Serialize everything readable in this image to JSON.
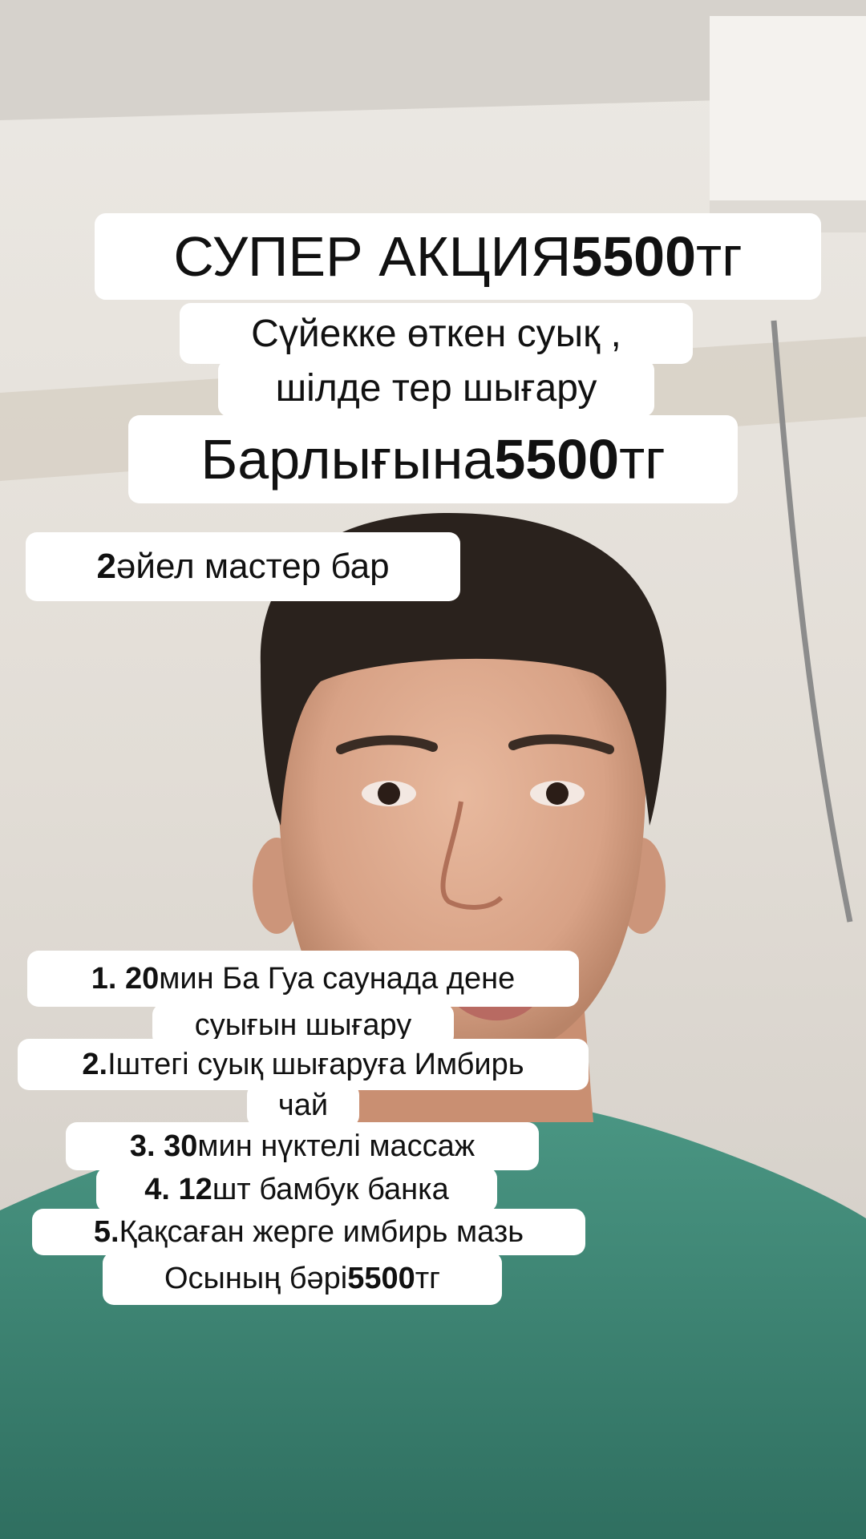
{
  "captions": {
    "headline": "СУПЕР АКЦИЯ 5500 тг",
    "headline_parts": {
      "text": "СУПЕР АКЦИЯ ",
      "number": "5500",
      "unit": " тг"
    },
    "sub1": "Сүйекке өткен суық ,",
    "sub2": "шілде тер шығару",
    "price_line": {
      "text": "Барлығына ",
      "number": "5500",
      "unit": " тг"
    },
    "masters": {
      "number": "2",
      "text": " әйел мастер бар"
    },
    "list": [
      {
        "num": "1. 20",
        "text": " мин  Ба Гуа саунада дене"
      },
      {
        "num": "",
        "text": "суығын шығару"
      },
      {
        "num": "2.",
        "text": " Іштегі суық шығаруға Имбирь"
      },
      {
        "num": "",
        "text": "чай"
      },
      {
        "num": "3. 30",
        "text": " мин нүктелі массаж"
      },
      {
        "num": "4. 12",
        "text": " шт бамбук банка"
      },
      {
        "num": "5.",
        "text": " Қақсаған жерге имбирь мазь"
      },
      {
        "num": "",
        "text": "Осының бәрі ",
        "tail_num": "5500",
        "tail": " тг"
      }
    ]
  },
  "colors": {
    "shirt": "#3f8a78",
    "wall": "#e6e2dc",
    "caption_bg": "#ffffff"
  }
}
